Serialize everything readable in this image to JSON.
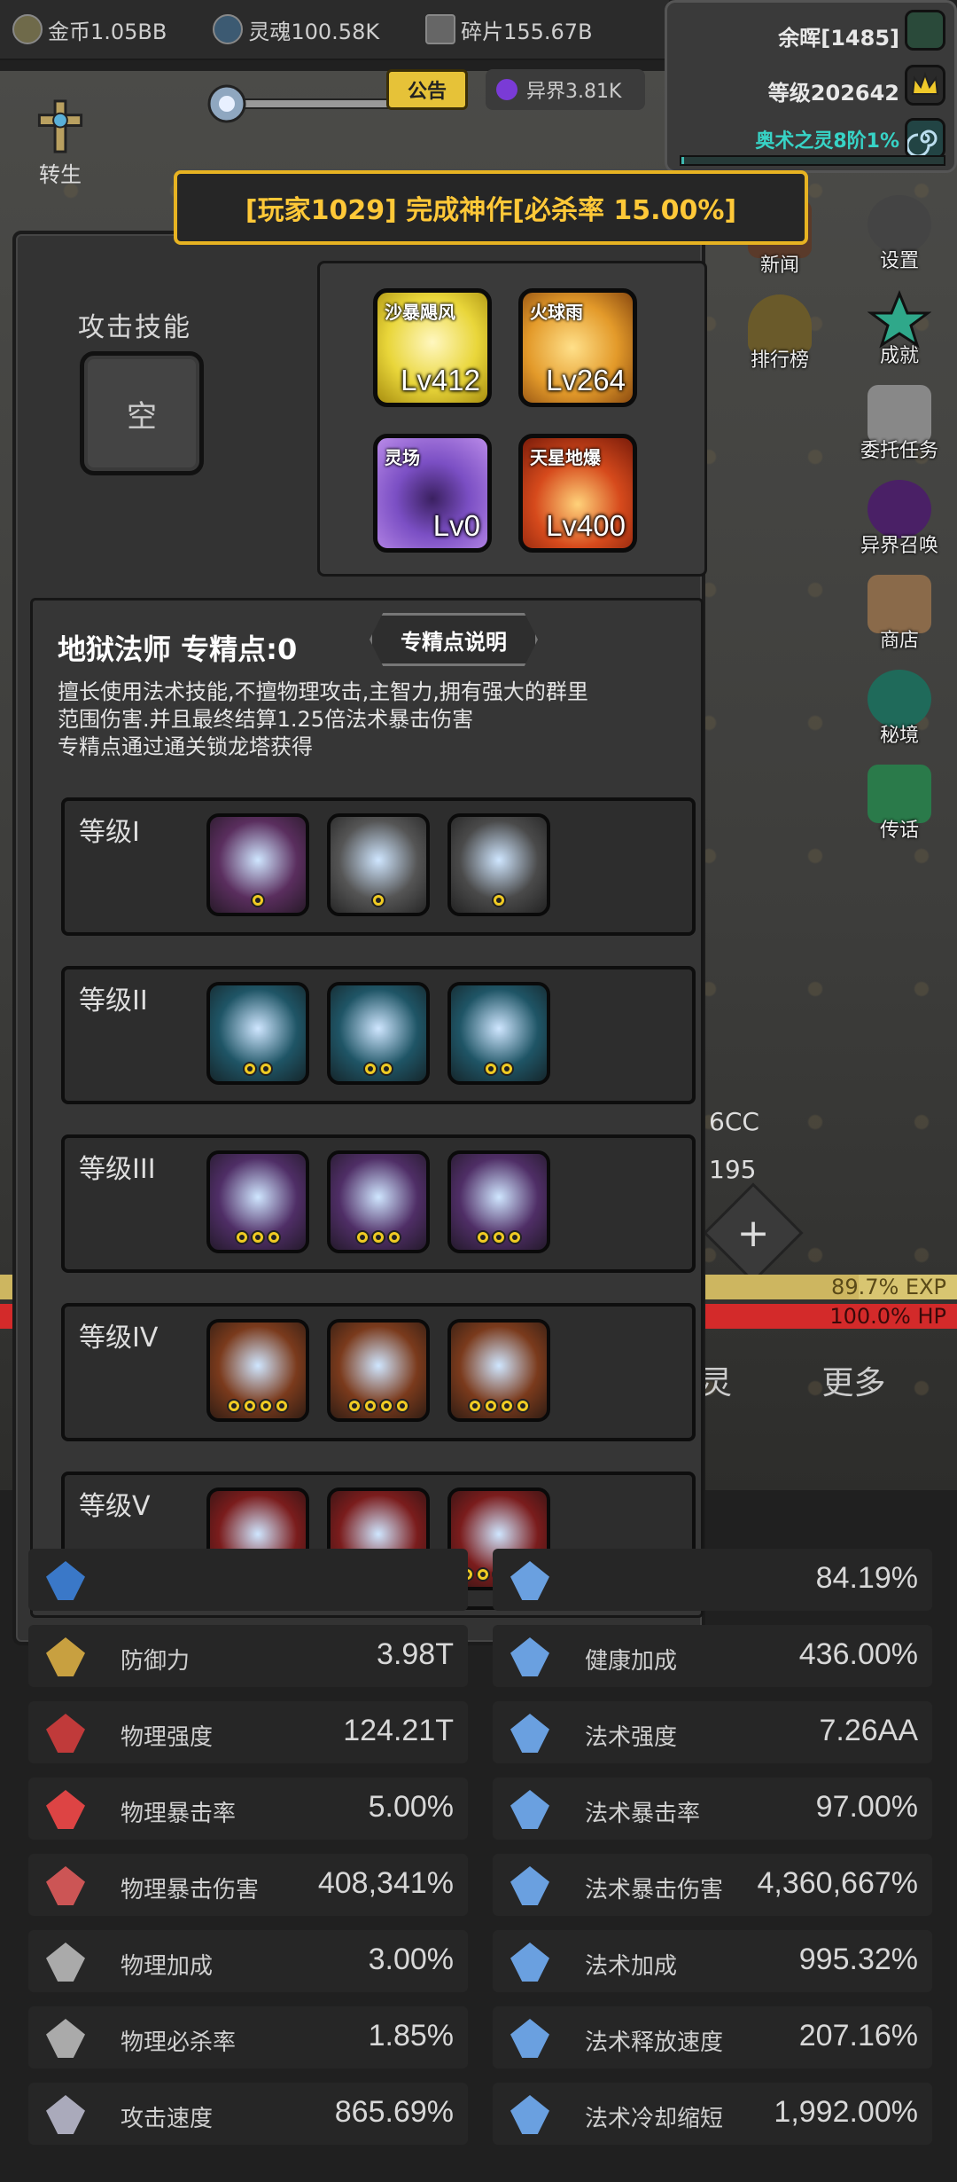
{
  "resources": [
    {
      "icon": "gold-coin-icon",
      "label": "金币1.05BB"
    },
    {
      "icon": "soul-icon",
      "label": "灵魂100.58K"
    },
    {
      "icon": "shard-icon",
      "label": "碎片155.67B"
    }
  ],
  "player": {
    "afterglow": "余晖[1485]",
    "level": "等级202642",
    "realm": "奥术之灵8阶1%",
    "realm_progress": 0.01
  },
  "notice_label": "公告",
  "otherworld": "异界3.81K",
  "rebirth_label": "转生",
  "announcement": "[玩家1029] 完成神作[必杀率 15.00%]",
  "right_menu": [
    {
      "icon": "gear-icon",
      "label": "设置"
    },
    {
      "icon": "star-icon",
      "label": "成就"
    },
    {
      "icon": "scroll-icon",
      "label": "委托任务"
    },
    {
      "icon": "portal-icon",
      "label": "异界召唤"
    },
    {
      "icon": "shop-icon",
      "label": "商店"
    },
    {
      "icon": "vortex-icon",
      "label": "秘境"
    },
    {
      "icon": "horn-icon",
      "label": "传话"
    }
  ],
  "mid_menu": [
    {
      "icon": "newspaper-icon",
      "label": "新闻"
    },
    {
      "icon": "trophy-icon",
      "label": "排行榜"
    }
  ],
  "panel": {
    "attack_skill_label": "攻击技能",
    "empty_slot": "空",
    "skills": [
      {
        "name": "沙暴飓风",
        "level": "Lv412",
        "color": "#e9d63a"
      },
      {
        "name": "火球雨",
        "level": "Lv264",
        "color": "#e39a2a"
      },
      {
        "name": "灵场",
        "level": "Lv0",
        "color": "#7b4fc4"
      },
      {
        "name": "天星地爆",
        "level": "Lv400",
        "color": "#d64a1c"
      }
    ],
    "spec_title": "地狱法师 专精点:0",
    "spec_button": "专精点说明",
    "spec_desc": [
      "擅长使用法术技能,不擅物理攻击,主智力,拥有强大的群里",
      "范围伤害.并且最终结算1.25倍法术暴击伤害",
      "专精点通过通关锁龙塔获得"
    ],
    "tiers": [
      {
        "name": "等级I",
        "pips": 1,
        "talents": [
          {
            "icon": "magic-burst-icon",
            "bg": "#5a2e5e"
          },
          {
            "icon": "scroll-icon",
            "bg": "#555"
          },
          {
            "icon": "ice-shard-icon",
            "bg": "#4a4a4a"
          }
        ]
      },
      {
        "name": "等级II",
        "pips": 2,
        "talents": [
          {
            "icon": "spine-icon",
            "bg": "#1f5566"
          },
          {
            "icon": "explosion-icon",
            "bg": "#1f5566"
          },
          {
            "icon": "ice-wall-icon",
            "bg": "#1f5566"
          }
        ]
      },
      {
        "name": "等级III",
        "pips": 3,
        "talents": [
          {
            "icon": "scroll-icon",
            "bg": "#4f2e66"
          },
          {
            "icon": "spine-icon",
            "bg": "#4f2e66"
          },
          {
            "icon": "ice-wall-icon",
            "bg": "#4f2e66"
          }
        ]
      },
      {
        "name": "等级IV",
        "pips": 4,
        "talents": [
          {
            "icon": "ice-wall-icon",
            "bg": "#7a3a1c"
          },
          {
            "icon": "explosion-icon",
            "bg": "#7a3a1c"
          },
          {
            "icon": "pentagram-icon",
            "bg": "#7a3a1c"
          }
        ]
      },
      {
        "name": "等级V",
        "pips": 5,
        "talents": [
          {
            "icon": "ghost-icon",
            "bg": "#7a1c1c"
          },
          {
            "icon": "ice-shard-icon",
            "bg": "#7a1c1c"
          },
          {
            "icon": "ice-wall-icon",
            "bg": "#7a1c1c"
          }
        ]
      }
    ]
  },
  "background": {
    "value1": "6CC",
    "value2": "195",
    "exp_text": "89.7% EXP",
    "exp_fraction": 0.897,
    "hp_text": "100.0% HP",
    "tab1": "灵",
    "tab2": "更多"
  },
  "stats": [
    {
      "left": {
        "name": "",
        "value": ""
      },
      "right": {
        "name": "",
        "value": "84.19%"
      }
    },
    {
      "left": {
        "name": "防御力",
        "value": "3.98T"
      },
      "right": {
        "name": "健康加成",
        "value": "436.00%"
      }
    },
    {
      "left": {
        "name": "物理强度",
        "value": "124.21T"
      },
      "right": {
        "name": "法术强度",
        "value": "7.26AA"
      }
    },
    {
      "left": {
        "name": "物理暴击率",
        "value": "5.00%"
      },
      "right": {
        "name": "法术暴击率",
        "value": "97.00%"
      }
    },
    {
      "left": {
        "name": "物理暴击伤害",
        "value": "408,341%"
      },
      "right": {
        "name": "法术暴击伤害",
        "value": "4,360,667%"
      }
    },
    {
      "left": {
        "name": "物理加成",
        "value": "3.00%"
      },
      "right": {
        "name": "法术加成",
        "value": "995.32%"
      }
    },
    {
      "left": {
        "name": "物理必杀率",
        "value": "1.85%"
      },
      "right": {
        "name": "法术释放速度",
        "value": "207.16%"
      }
    },
    {
      "left": {
        "name": "攻击速度",
        "value": "865.69%"
      },
      "right": {
        "name": "法术冷却缩短",
        "value": "1,992.00%"
      }
    }
  ]
}
